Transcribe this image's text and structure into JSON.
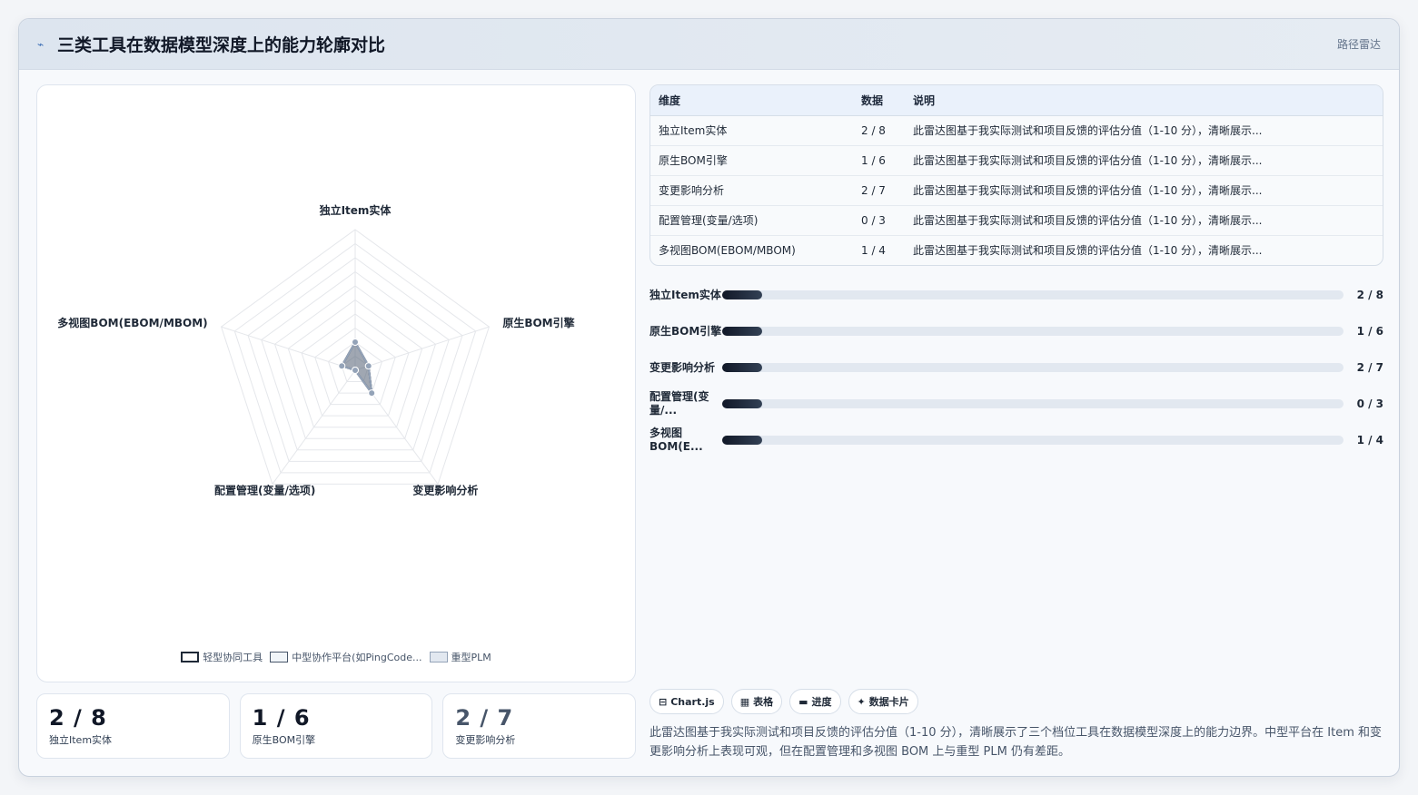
{
  "header": {
    "title": "三类工具在数据模型深度上的能力轮廓对比",
    "tag": "路径雷达",
    "icon": "route-icon"
  },
  "chart_data": {
    "type": "radar",
    "axes": [
      "独立Item实体",
      "原生BOM引擎",
      "变更影响分析",
      "配置管理(变量/选项)",
      "多视图BOM(EBOM/MBOM)"
    ],
    "rlim": [
      0,
      10
    ],
    "series": [
      {
        "name": "轻型协同工具",
        "values": [
          2,
          1,
          2,
          0,
          1
        ]
      },
      {
        "name": "中型协作平台(如PingCode...",
        "values": [
          2,
          1,
          2,
          0,
          1
        ]
      },
      {
        "name": "重型PLM",
        "values": [
          2,
          1,
          2,
          0,
          1
        ]
      }
    ],
    "legend": "bottom"
  },
  "stats": [
    {
      "value": "2 / 8",
      "label": "独立Item实体"
    },
    {
      "value": "1 / 6",
      "label": "原生BOM引擎"
    },
    {
      "value": "2 / 7",
      "label": "变更影响分析"
    }
  ],
  "table": {
    "headers": [
      "维度",
      "数据",
      "说明"
    ],
    "rows": [
      [
        "独立Item实体",
        "2 / 8",
        "此雷达图基于我实际测试和项目反馈的评估分值（1-10 分），清晰展示..."
      ],
      [
        "原生BOM引擎",
        "1 / 6",
        "此雷达图基于我实际测试和项目反馈的评估分值（1-10 分），清晰展示..."
      ],
      [
        "变更影响分析",
        "2 / 7",
        "此雷达图基于我实际测试和项目反馈的评估分值（1-10 分），清晰展示..."
      ],
      [
        "配置管理(变量/选项)",
        "0 / 3",
        "此雷达图基于我实际测试和项目反馈的评估分值（1-10 分），清晰展示..."
      ],
      [
        "多视图BOM(EBOM/MBOM)",
        "1 / 4",
        "此雷达图基于我实际测试和项目反馈的评估分值（1-10 分），清晰展示..."
      ]
    ]
  },
  "progress": [
    {
      "label": "独立Item实体",
      "value": "2 / 8",
      "fill": 0.064
    },
    {
      "label": "原生BOM引擎",
      "value": "1 / 6",
      "fill": 0.064
    },
    {
      "label": "变更影响分析",
      "value": "2 / 7",
      "fill": 0.064
    },
    {
      "label": "配置管理(变量/...",
      "value": "0 / 3",
      "fill": 0.064
    },
    {
      "label": "多视图BOM(E...",
      "value": "1 / 4",
      "fill": 0.064
    }
  ],
  "chips": [
    {
      "icon": "⊟",
      "label": "Chart.js"
    },
    {
      "icon": "▦",
      "label": "表格"
    },
    {
      "icon": "▬",
      "label": "进度"
    },
    {
      "icon": "✦",
      "label": "数据卡片"
    }
  ],
  "description": "此雷达图基于我实际测试和项目反馈的评估分值（1-10 分），清晰展示了三个档位工具在数据模型深度上的能力边界。中型平台在 Item 和变更影响分析上表现可观，但在配置管理和多视图 BOM 上与重型 PLM 仍有差距。",
  "colors": {
    "series1": "#111827",
    "series2": "#475569",
    "series3": "#94a3b8",
    "grid": "#e5e7eb"
  }
}
